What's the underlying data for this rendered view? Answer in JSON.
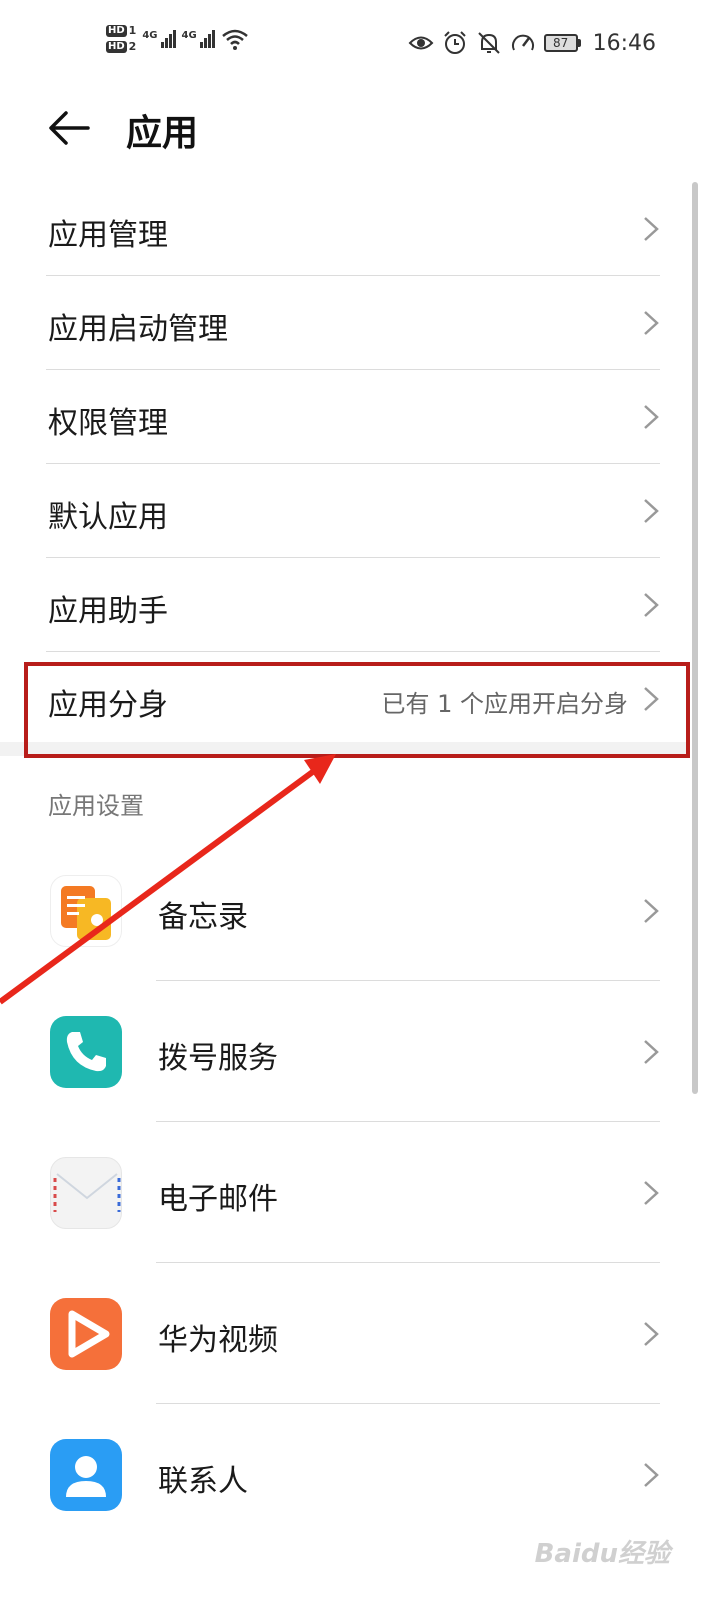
{
  "status_bar": {
    "hd1": "HD",
    "hd1_num": "1",
    "hd2": "HD",
    "hd2_num": "2",
    "net1": "4G",
    "net2": "4G",
    "battery": "87",
    "time": "16:46",
    "icons": [
      "eye-icon",
      "alarm-icon",
      "bell-off-icon",
      "speed-icon"
    ]
  },
  "header": {
    "title": "应用",
    "back_icon": "arrow-left-icon"
  },
  "menu": [
    {
      "label": "应用管理"
    },
    {
      "label": "应用启动管理"
    },
    {
      "label": "权限管理"
    },
    {
      "label": "默认应用"
    },
    {
      "label": "应用助手"
    },
    {
      "label": "应用分身",
      "value": "已有 1 个应用开启分身"
    }
  ],
  "section": {
    "title": "应用设置"
  },
  "apps": [
    {
      "label": "备忘录",
      "icon": "notepad-icon",
      "color": "#f59e22"
    },
    {
      "label": "拨号服务",
      "icon": "phone-icon",
      "color": "#1fb8b0"
    },
    {
      "label": "电子邮件",
      "icon": "envelope-icon",
      "color": "#f3f3f3"
    },
    {
      "label": "华为视频",
      "icon": "play-icon",
      "color": "#f5703a"
    },
    {
      "label": "联系人",
      "icon": "contact-icon",
      "color": "#2a9df4"
    }
  ],
  "annotation_color": "#b81d1a",
  "watermark": "Baidu经验"
}
